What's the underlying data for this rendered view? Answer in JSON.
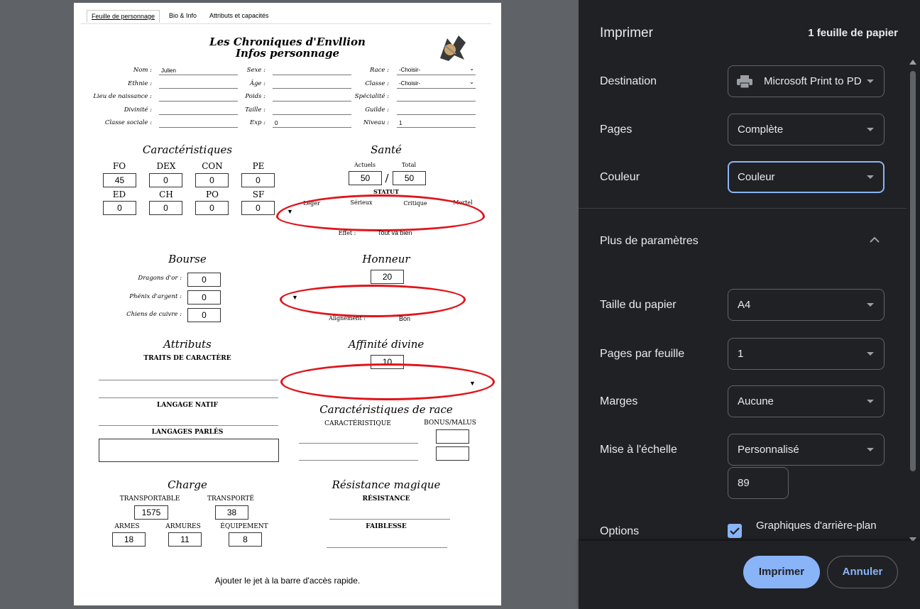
{
  "sheet": {
    "tabs": [
      "Feuille de personnage",
      "Bio & Info",
      "Attributs et capacités"
    ],
    "title1": "Les Chroniques d'Envllion",
    "title2": "Infos personnage",
    "fields": {
      "nom_label": "Nom :",
      "nom_value": "Julien",
      "ethnie_label": "Ethnie :",
      "lieu_label": "Lieu de naissance :",
      "divinite_label": "Divinité :",
      "classe_sociale_label": "Classe sociale :",
      "sexe_label": "Sexe :",
      "age_label": "Âge :",
      "poids_label": "Poids :",
      "taille_label": "Taille :",
      "exp_label": "Exp :",
      "exp_value": "0",
      "race_label": "Race :",
      "race_value": "-Choisir-",
      "classe_label": "Classe :",
      "classe_value": "-Choisir-",
      "specialite_label": "Spécialité :",
      "guilde_label": "Guilde :",
      "niveau_label": "Niveau :",
      "niveau_value": "1"
    },
    "caracteristiques": {
      "title": "Caractéristiques",
      "row1": [
        {
          "label": "FO",
          "value": "45"
        },
        {
          "label": "DEX",
          "value": "0"
        },
        {
          "label": "CON",
          "value": "0"
        },
        {
          "label": "PE",
          "value": "0"
        }
      ],
      "row2": [
        {
          "label": "ED",
          "value": "0"
        },
        {
          "label": "CH",
          "value": "0"
        },
        {
          "label": "PO",
          "value": "0"
        },
        {
          "label": "SF",
          "value": "0"
        }
      ]
    },
    "sante": {
      "title": "Santé",
      "actuels_label": "Actuels",
      "actuels": "50",
      "total_label": "Total",
      "total": "50",
      "slash": "/",
      "statut": "STATUT",
      "levels": [
        "Léger",
        "Sérieux",
        "Critique",
        "Mortel"
      ],
      "effet_label": "Effet :",
      "effet_value": "Tout va bien"
    },
    "bourse": {
      "title": "Bourse",
      "dragons_label": "Dragons d'or :",
      "dragons": "0",
      "phenix_label": "Phénix d'argent :",
      "phenix": "0",
      "chiens_label": "Chiens de cuivre :",
      "chiens": "0"
    },
    "honneur": {
      "title": "Honneur",
      "value": "20",
      "alignement_label": "Alignement :",
      "alignement_value": "Bon"
    },
    "attributs": {
      "title": "Attributs",
      "traits": "TRAITS DE CARACTÈRE",
      "langage_natif": "LANGAGE NATIF",
      "langages_parles": "LANGAGES PARLÉS"
    },
    "affinite": {
      "title": "Affinité divine",
      "value": "10"
    },
    "race_caracs": {
      "title": "Caractéristiques de race",
      "col1": "CARACTÉRISTIQUE",
      "col2": "BONUS/MALUS"
    },
    "charge": {
      "title": "Charge",
      "transportable_label": "TRANSPORTABLE",
      "transportable": "1575",
      "transporte_label": "TRANSPORTÉ",
      "transporte": "38",
      "armes_label": "ARMES",
      "armes": "18",
      "armures_label": "ARMURES",
      "armures": "11",
      "equipement_label": "ÉQUIPEMENT",
      "equipement": "8"
    },
    "resistance": {
      "title": "Résistance magique",
      "resistance_label": "RÉSISTANCE",
      "faiblesse_label": "FAIBLESSE"
    },
    "footer_text": "Ajouter le jet à la barre d'accès rapide."
  },
  "print": {
    "title": "Imprimer",
    "sheet_count": "1 feuille de papier",
    "destination_label": "Destination",
    "destination_value": "Microsoft Print to PD",
    "pages_label": "Pages",
    "pages_value": "Complète",
    "couleur_label": "Couleur",
    "couleur_value": "Couleur",
    "more_label": "Plus de paramètres",
    "paper_label": "Taille du papier",
    "paper_value": "A4",
    "pps_label": "Pages par feuille",
    "pps_value": "1",
    "marges_label": "Marges",
    "marges_value": "Aucune",
    "scale_label": "Mise à l'échelle",
    "scale_value": "Personnalisé",
    "scale_custom": "89",
    "options_label": "Options",
    "bg_graphics_label": "Graphiques d'arrière-plan",
    "print_button": "Imprimer",
    "cancel_button": "Annuler",
    "accent": "#8ab4f8"
  }
}
